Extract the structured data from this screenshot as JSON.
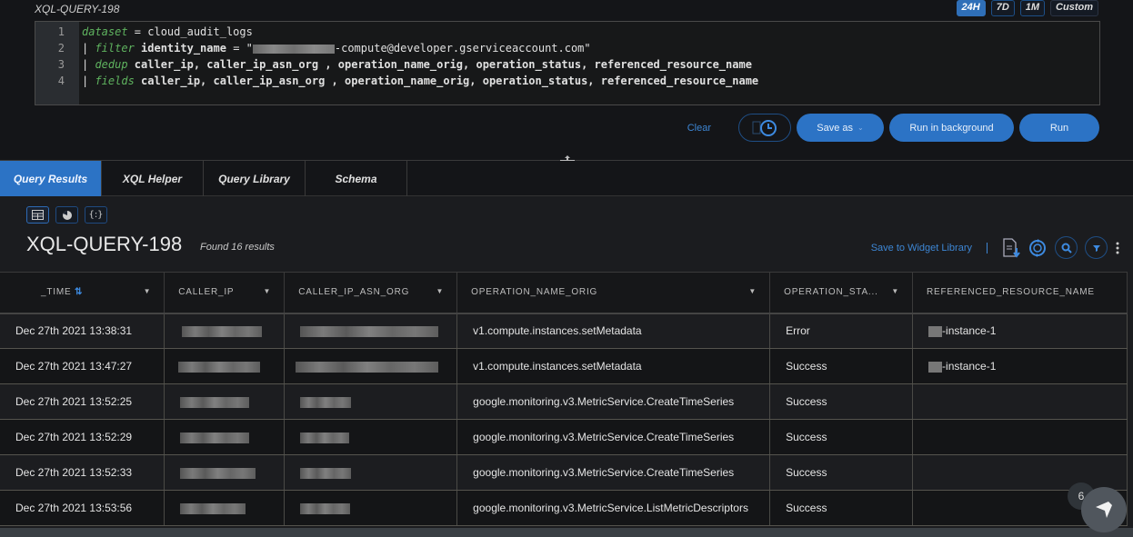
{
  "query": {
    "title": "XQL-QUERY-198",
    "time_ranges": [
      {
        "label": "24H",
        "active": true
      },
      {
        "label": "7D",
        "active": false
      },
      {
        "label": "1M",
        "active": false
      },
      {
        "label": "Custom",
        "active": false
      }
    ],
    "lines": [
      {
        "num": "1",
        "kw": "dataset",
        "rest": " = cloud_audit_logs"
      },
      {
        "num": "2",
        "prefix": "| ",
        "kw": "filter",
        "field": " identity_name",
        "rest_before": " = \"",
        "rest_after": "-compute@developer.gserviceaccount.com\""
      },
      {
        "num": "3",
        "prefix": "| ",
        "kw": "dedup",
        "rest": " caller_ip, caller_ip_asn_org , operation_name_orig, operation_status, referenced_resource_name"
      },
      {
        "num": "4",
        "prefix": "| ",
        "kw": "fields",
        "rest": " caller_ip, caller_ip_asn_org , operation_name_orig, operation_status, referenced_resource_name"
      }
    ]
  },
  "actions": {
    "clear": "Clear",
    "save_as": "Save as",
    "run_background": "Run in background",
    "run": "Run"
  },
  "tabs": [
    "Query Results",
    "XQL Helper",
    "Query Library",
    "Schema"
  ],
  "results": {
    "title": "XQL-QUERY-198",
    "found": "Found 16 results",
    "save_widget": "Save to Widget Library",
    "columns": [
      "_TIME",
      "CALLER_IP",
      "CALLER_IP_ASN_ORG",
      "OPERATION_NAME_ORIG",
      "OPERATION_STA...",
      "REFERENCED_RESOURCE_NAME"
    ],
    "rows": [
      {
        "time": "Dec 27th 2021 13:38:31",
        "op": "v1.compute.instances.setMetadata",
        "status": "Error",
        "resource": "-instance-1"
      },
      {
        "time": "Dec 27th 2021 13:47:27",
        "op": "v1.compute.instances.setMetadata",
        "status": "Success",
        "resource": "-instance-1"
      },
      {
        "time": "Dec 27th 2021 13:52:25",
        "op": "google.monitoring.v3.MetricService.CreateTimeSeries",
        "status": "Success",
        "resource": ""
      },
      {
        "time": "Dec 27th 2021 13:52:29",
        "op": "google.monitoring.v3.MetricService.CreateTimeSeries",
        "status": "Success",
        "resource": ""
      },
      {
        "time": "Dec 27th 2021 13:52:33",
        "op": "google.monitoring.v3.MetricService.CreateTimeSeries",
        "status": "Success",
        "resource": ""
      },
      {
        "time": "Dec 27th 2021 13:53:56",
        "op": "google.monitoring.v3.MetricService.ListMetricDescriptors",
        "status": "Success",
        "resource": ""
      }
    ]
  },
  "notification": {
    "count": "6"
  }
}
